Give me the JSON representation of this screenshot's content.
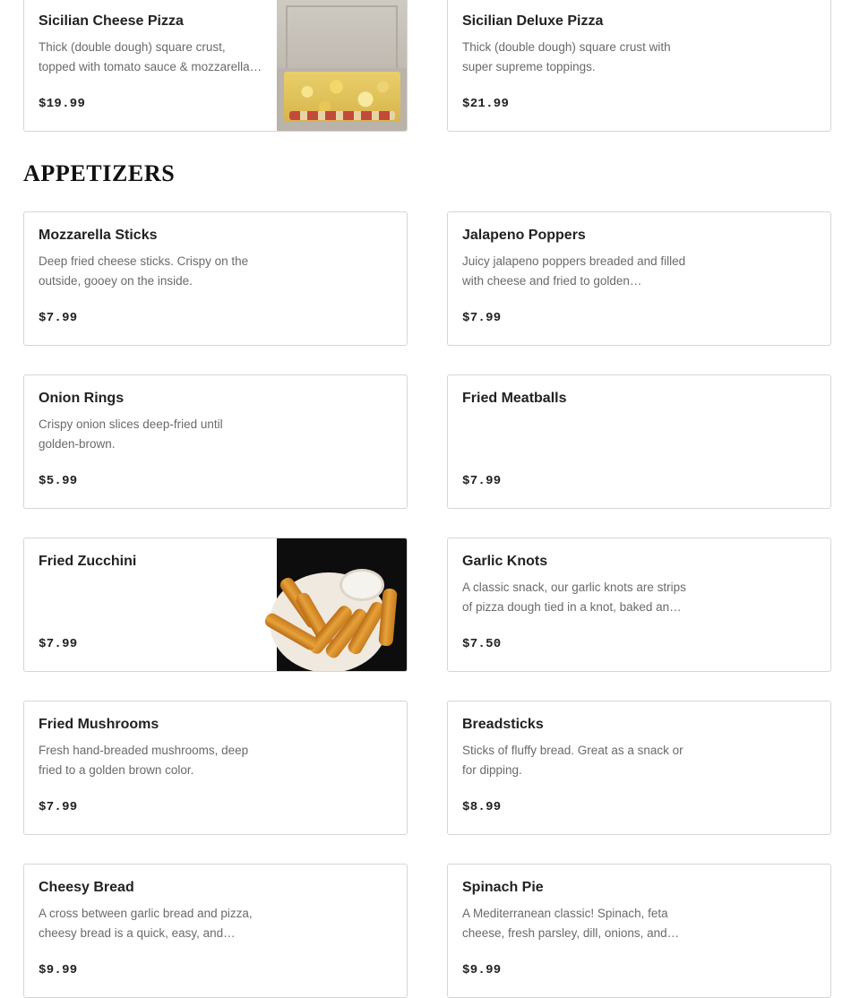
{
  "top_items": [
    {
      "name": "Sicilian Cheese Pizza",
      "description": "Thick (double dough) square crust, topped with tomato sauce & mozzarella cheese.",
      "price": "$19.99"
    },
    {
      "name": "Sicilian Deluxe Pizza",
      "description": "Thick (double dough) square crust with super supreme toppings.",
      "price": "$21.99"
    }
  ],
  "section": {
    "title": "APPETIZERS"
  },
  "appetizers": [
    {
      "name": "Mozzarella Sticks",
      "description": "Deep fried cheese sticks. Crispy on the outside, gooey on the inside.",
      "price": "$7.99"
    },
    {
      "name": "Jalapeno Poppers",
      "description": "Juicy jalapeno poppers breaded and filled with cheese and fried to golden perfection.",
      "price": "$7.99"
    },
    {
      "name": "Onion Rings",
      "description": "Crispy onion slices deep-fried until golden-brown.",
      "price": "$5.99"
    },
    {
      "name": "Fried Meatballs",
      "description": "",
      "price": "$7.99"
    },
    {
      "name": "Fried Zucchini",
      "description": "",
      "price": "$7.99"
    },
    {
      "name": "Garlic Knots",
      "description": "A classic snack, our garlic knots are strips of pizza dough tied in a knot, baked and topped with garlic butter.",
      "price": "$7.50"
    },
    {
      "name": "Fried Mushrooms",
      "description": "Fresh hand-breaded mushrooms, deep fried to a golden brown color.",
      "price": "$7.99"
    },
    {
      "name": "Breadsticks",
      "description": "Sticks of fluffy bread. Great as a snack or for dipping.",
      "price": "$8.99"
    },
    {
      "name": "Cheesy Bread",
      "description": "A cross between garlic bread and pizza, cheesy bread is a quick, easy, and delicious snack.",
      "price": "$9.99"
    },
    {
      "name": "Spinach Pie",
      "description": "A Mediterranean classic! Spinach, feta cheese, fresh parsley, dill, onions, and spices.",
      "price": "$9.99"
    }
  ],
  "colors": {
    "border": "#d6d6d6",
    "text": "#222222",
    "muted": "#6a6a6a"
  }
}
